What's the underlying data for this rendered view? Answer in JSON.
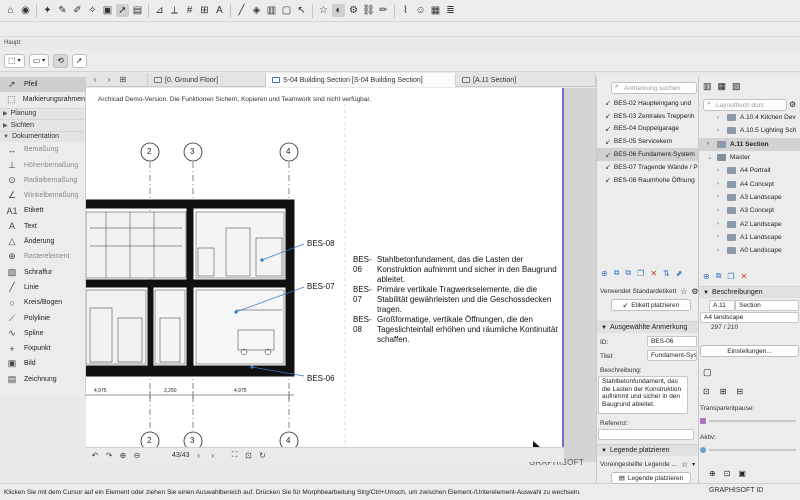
{
  "toolbar": {
    "icons": [
      "home-icon",
      "camera-icon",
      "bulb-icon",
      "eyedropper-icon",
      "pen-icon",
      "wand-icon",
      "square-icon",
      "pointer-icon",
      "unknown-icon",
      "ruler-icon",
      "measure-icon",
      "grid-icon",
      "hash-icon",
      "text-icon",
      "line-icon",
      "paint-icon",
      "layer-icon",
      "frame-icon",
      "cursor-icon",
      "star-icon",
      "bell-icon",
      "gear-icon",
      "link-icon",
      "pencil-icon",
      "brush-icon",
      "person-icon",
      "chart-icon",
      "layers-icon"
    ]
  },
  "haupt": "Haupt:",
  "tabs": [
    {
      "label": "[0. Ground Floor]"
    },
    {
      "label": "S-04 Building Section [S-04 Building Section]"
    },
    {
      "label": "[A.11 Section]"
    }
  ],
  "left_panel": {
    "items": [
      {
        "label": "Pfeil",
        "icon": "arrow-icon",
        "kind": "tool",
        "selected": true
      },
      {
        "label": "Markierungsrahmen",
        "icon": "marquee-icon",
        "kind": "tool"
      },
      {
        "label": "Planung",
        "kind": "group"
      },
      {
        "label": "Sichten",
        "kind": "group"
      },
      {
        "label": "Dokumentation",
        "kind": "group-open"
      },
      {
        "label": "Bemaßung",
        "icon": "dimension-icon",
        "kind": "tool",
        "dim": true
      },
      {
        "label": "Höhenbemaßung",
        "icon": "level-dim-icon",
        "kind": "tool",
        "dim": true
      },
      {
        "label": "Radialbemaßung",
        "icon": "radial-dim-icon",
        "kind": "tool",
        "dim": true
      },
      {
        "label": "Winkelbemaßung",
        "icon": "angle-dim-icon",
        "kind": "tool",
        "dim": true
      },
      {
        "label": "Etikett",
        "icon": "label-icon",
        "kind": "tool"
      },
      {
        "label": "Text",
        "icon": "text-icon",
        "kind": "tool"
      },
      {
        "label": "Änderung",
        "icon": "change-icon",
        "kind": "tool"
      },
      {
        "label": "Rasterelement",
        "icon": "grid-element-icon",
        "kind": "tool",
        "dim": true
      },
      {
        "label": "Schraffur",
        "icon": "fill-icon",
        "kind": "tool"
      },
      {
        "label": "Linie",
        "icon": "line-icon",
        "kind": "tool"
      },
      {
        "label": "Kreis/Bogen",
        "icon": "circle-icon",
        "kind": "tool"
      },
      {
        "label": "Polylinie",
        "icon": "polyline-icon",
        "kind": "tool"
      },
      {
        "label": "Spline",
        "icon": "spline-icon",
        "kind": "tool"
      },
      {
        "label": "Fixpunkt",
        "icon": "hotspot-icon",
        "kind": "tool"
      },
      {
        "label": "Bild",
        "icon": "image-icon",
        "kind": "tool"
      },
      {
        "label": "Zeichnung",
        "icon": "drawing-icon",
        "kind": "tool"
      }
    ]
  },
  "canvas": {
    "demo_note": "Archicad Demo-Version. Die Funktionen Sichern, Kopieren und Teamwork sind nicht verfügbar.",
    "grid_labels": [
      "2",
      "3",
      "4"
    ],
    "bes_labels": [
      "BES-08",
      "BES-07",
      "BES-06"
    ],
    "dimensions": [
      "4,975",
      "2,250",
      "4,975"
    ],
    "legend": [
      {
        "code": "BES-06",
        "text": "Stahlbetonfundament, das die Lasten der Konstruktion aufnimmt und sicher in den Baugrund ableitet."
      },
      {
        "code": "BES-07",
        "text": "Primäre vertikale Tragwerkselemente, die die Stabilität gewährleisten und die Geschossdecken tragen."
      },
      {
        "code": "BES-08",
        "text": "Großformatige, vertikale Öffnungen, die den Tageslichteinfall erhöhen und räumliche Kontinuität schaffen."
      }
    ],
    "logo": "GRAPHISOFT"
  },
  "bottom_nav": {
    "page": "43/43"
  },
  "status_bar": "Klicken Sie mit dem Cursor auf ein Element oder ziehen Sie einen Auswahlbereich auf. Drücken Sie für Morphbearbeitung Strg/Ctrl+Umsch, um zwischen Element-/Unterelement-Auswahl zu wechseln.",
  "annotations_panel": {
    "search_placeholder": "Anmerkung suchen",
    "items": [
      {
        "label": "BES-02 Haupteingang und"
      },
      {
        "label": "BES-03 Zentrales Treppenh"
      },
      {
        "label": "BES-04 Doppelgarage"
      },
      {
        "label": "BES-05 Servicekern"
      },
      {
        "label": "BES-06 Fundament-System",
        "selected": true
      },
      {
        "label": "BES-07 Tragende Wände / P"
      },
      {
        "label": "BES-08 Raumhohe Öffnung"
      }
    ],
    "standard_label": "Verwendet Standardetikett",
    "place_label_btn": "Etikett platzieren",
    "selected_header": "Ausgewählte Anmerkung",
    "id_label": "ID:",
    "id_value": "BES-06",
    "title_label": "Titel:",
    "title_value": "Fundament-Syst",
    "desc_label": "Beschreibung:",
    "desc_value": "Stahlbetonfundament, das die Lasten der Konstruktion aufnimmt und sicher in den Baugrund ableitet.",
    "ref_label": "Referenz:",
    "legend_header": "Legende platzieren",
    "preset_label": "Voreingestellte Legende ...",
    "place_legend_btn": "Legende platzieren"
  },
  "layout_panel": {
    "search_placeholder": "Layoutbuch durc",
    "tree": [
      {
        "label": "A.10.4 Kitchen Dev",
        "type": "page",
        "level": 1
      },
      {
        "label": "A.10.5 Lighting Sch",
        "type": "page",
        "level": 1
      },
      {
        "label": "A.11 Section",
        "type": "page",
        "level": 0,
        "selected": true
      },
      {
        "label": "Master",
        "type": "folder",
        "level": 0
      },
      {
        "label": "A4 Portrait",
        "type": "page",
        "level": 1
      },
      {
        "label": "A4 Concept",
        "type": "page",
        "level": 1
      },
      {
        "label": "A3 Landscape",
        "type": "page",
        "level": 1
      },
      {
        "label": "A3 Concept",
        "type": "page",
        "level": 1
      },
      {
        "label": "A2 Landscape",
        "type": "page",
        "level": 1
      },
      {
        "label": "A1 Landscape",
        "type": "page",
        "level": 1
      },
      {
        "label": "A0 Landscape",
        "type": "page",
        "level": 1
      }
    ],
    "desc_header": "Beschreibungen",
    "id_value": "A.11",
    "name_value": "Section",
    "master_value": "A4 landscape",
    "count_value": "297 / 210",
    "settings_btn": "Einstellungen...",
    "transparency_label": "Transparentpause:",
    "active_label": "Aktiv:"
  },
  "graphisoft_id": "GRAPHISOFT ID"
}
